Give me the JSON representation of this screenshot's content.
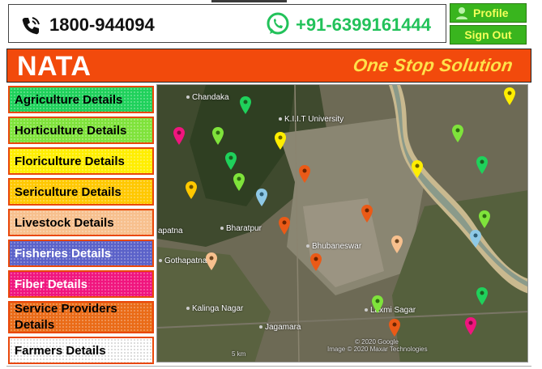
{
  "header": {
    "phone": "1800-944094",
    "whatsapp": "+91-6399161444",
    "profile_label": "Profile",
    "signout_label": "Sign Out"
  },
  "brand": {
    "name": "NATA",
    "slogan": "One Stop Solution",
    "color": "#f24a0c",
    "slogan_color": "#ffe24a"
  },
  "menu": [
    {
      "label": "Agriculture Details",
      "color": "#1fd15b"
    },
    {
      "label": "Horticulture Details",
      "color": "#7fe33b"
    },
    {
      "label": "Floriculture Details",
      "color": "#ffee00"
    },
    {
      "label": "Sericulture Details",
      "color": "#ffc800"
    },
    {
      "label": "Livestock Details",
      "color": "#f7c08e"
    },
    {
      "label": "Fisheries Details",
      "color": "#5b62c9"
    },
    {
      "label": "Fiber Details",
      "color": "#f0157e"
    },
    {
      "label": "Service Providers Details",
      "color": "#ea6b17"
    },
    {
      "label": "Farmers Details",
      "color": "#ffffff"
    }
  ],
  "map": {
    "places": [
      "Chandaka",
      "K.I.I.T University",
      "apatna",
      "Bharatpur",
      "Bhubaneswar",
      "Gothapatna",
      "Kalinga Nagar",
      "Jagamara",
      "Laxmi Sagar"
    ],
    "copyright": "© 2020 Google",
    "imagery": "Image © 2020 Maxar Technologies",
    "scale": "5 km",
    "pin_colors": [
      "#1fd15b",
      "#7fe33b",
      "#ffee00",
      "#ffc800",
      "#f7c08e",
      "#5b62c9",
      "#f0157e",
      "#ea6b17",
      "#8ec9e6"
    ]
  }
}
